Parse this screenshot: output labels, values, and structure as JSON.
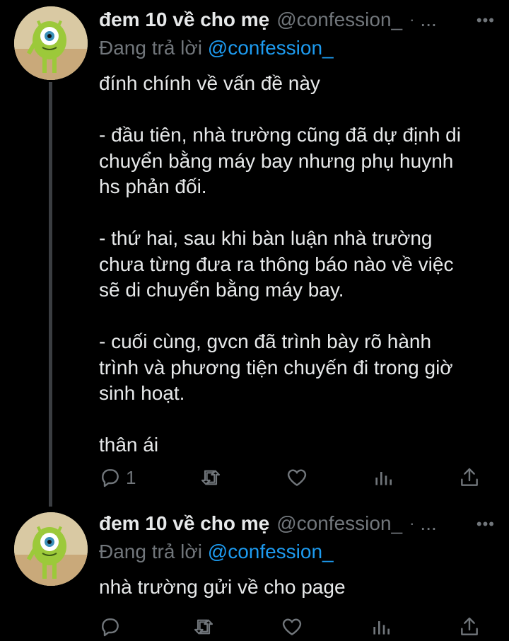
{
  "tweets": [
    {
      "name": "đem 10 về cho mẹ",
      "handle": "@confession_",
      "dot": "·",
      "time": "...",
      "more": "•••",
      "reply_prefix": "Đang trả lời ",
      "reply_to": "@confession_",
      "lines": [
        "đính chính về vấn đề này",
        "",
        "- đầu tiên, nhà trường cũng đã dự định di",
        "chuyển bằng máy bay nhưng phụ huynh",
        "hs phản đối.",
        "",
        "- thứ hai, sau khi bàn luận nhà trường",
        "chưa từng đưa ra thông báo nào về việc",
        "sẽ di chuyển bằng máy bay.",
        "",
        "- cuối cùng, gvcn đã trình bày rõ hành",
        "trình và phương tiện chuyến đi trong giờ",
        "sinh hoạt.",
        "",
        "thân ái"
      ],
      "reply_count": "1",
      "icons": [
        "reply-icon",
        "retweet-icon",
        "like-icon",
        "views-icon",
        "share-icon"
      ]
    },
    {
      "name": "đem 10 về cho mẹ",
      "handle": "@confession_",
      "dot": "·",
      "time": "...",
      "more": "•••",
      "reply_prefix": "Đang trả lời ",
      "reply_to": "@confession_",
      "lines": [
        "nhà trường gửi về cho page"
      ],
      "reply_count": "",
      "icons": [
        "reply-icon",
        "retweet-icon",
        "like-icon",
        "views-icon",
        "share-icon"
      ]
    }
  ],
  "colors": {
    "background": "#000000",
    "text": "#e7e9ea",
    "muted": "#71767b",
    "link": "#1d9bf0",
    "thread_line": "#3a3d41"
  }
}
